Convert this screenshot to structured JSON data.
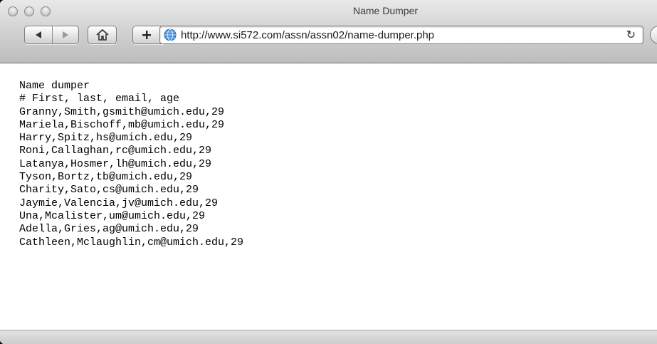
{
  "window": {
    "title": "Name Dumper"
  },
  "toolbar": {
    "back_icon": "back-arrow-icon",
    "forward_icon": "forward-arrow-icon",
    "home_icon": "home-icon",
    "add_bookmark_icon": "plus-icon",
    "site_icon": "globe-icon",
    "reload_icon": "reload-icon",
    "url": "http://www.si572.com/assn/assn02/name-dumper.php"
  },
  "page": {
    "lines": [
      "Name dumper",
      "# First, last, email, age",
      "Granny,Smith,gsmith@umich.edu,29",
      "Mariela,Bischoff,mb@umich.edu,29",
      "Harry,Spitz,hs@umich.edu,29",
      "Roni,Callaghan,rc@umich.edu,29",
      "Latanya,Hosmer,lh@umich.edu,29",
      "Tyson,Bortz,tb@umich.edu,29",
      "Charity,Sato,cs@umich.edu,29",
      "Jaymie,Valencia,jv@umich.edu,29",
      "Una,Mcalister,um@umich.edu,29",
      "Adella,Gries,ag@umich.edu,29",
      "Cathleen,Mclaughlin,cm@umich.edu,29"
    ]
  }
}
